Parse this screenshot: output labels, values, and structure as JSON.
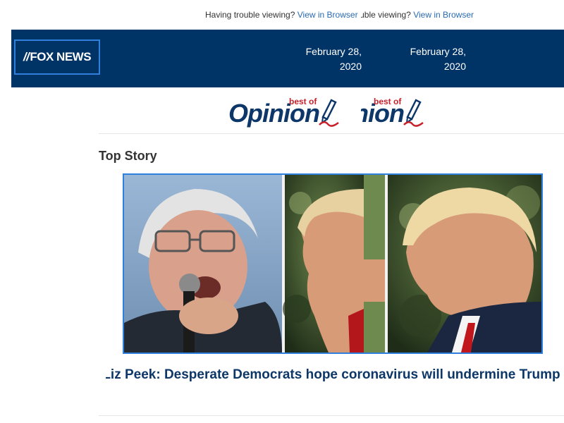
{
  "preheader": {
    "text": "Having trouble viewing?",
    "link": "View in Browser"
  },
  "header": {
    "logo": "FOX NEWS",
    "date": "February 28, 2020"
  },
  "opinion_logo": {
    "word": "Opinion",
    "tag": "best of"
  },
  "section": {
    "title": "Top Story"
  },
  "story": {
    "headline": "Liz Peek: Desperate Democrats hope coronavirus will undermine Trump"
  },
  "colors": {
    "header_bg": "#003366",
    "accent_blue": "#2f7fdc",
    "link": "#2a6ab3",
    "headline": "#0c3768",
    "brand_red": "#c7202b"
  }
}
